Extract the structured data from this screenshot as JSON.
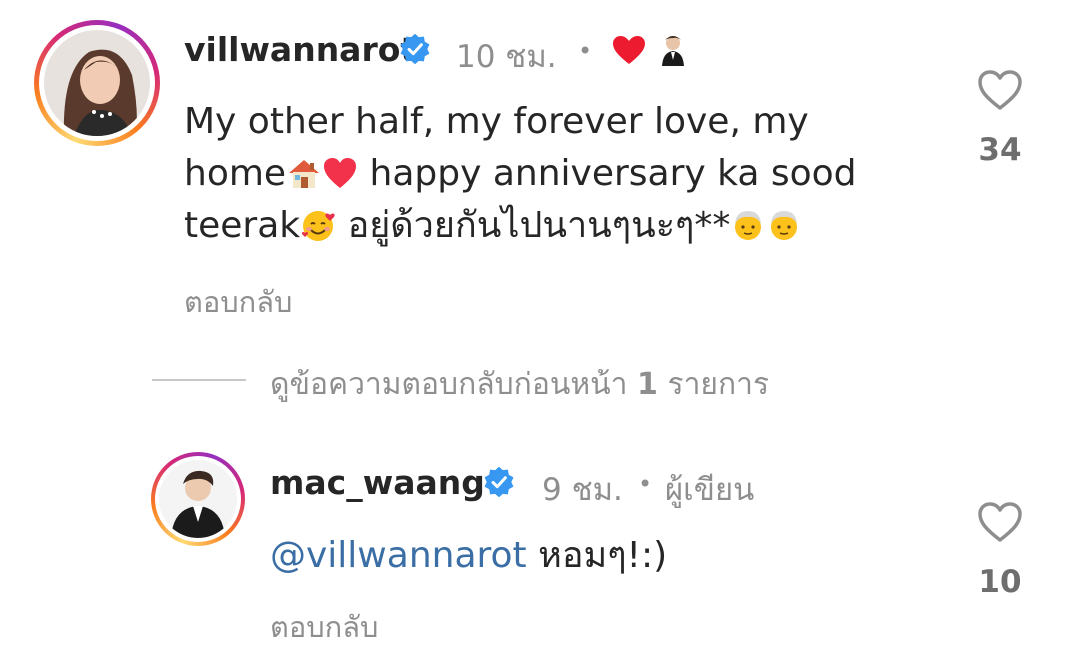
{
  "comment": {
    "username": "villwannarot",
    "time": "10 ชม.",
    "separator": "•",
    "text_line1": "My other half, my forever love, my",
    "text_line2a": "home",
    "text_line2b": " happy anniversary ka sood",
    "text_line3a": "teerak",
    "text_line3b": " อยู่ด้วยกันไปนานๆนะๆ**",
    "reply_label": "ตอบกลับ",
    "like_count": "34",
    "liked_by_author": true
  },
  "view_replies": {
    "prefix": "ดูข้อความตอบกลับก่อนหน้า",
    "count": "1",
    "suffix": "รายการ"
  },
  "reply": {
    "username": "mac_waang",
    "time": "9 ชม.",
    "separator": "•",
    "author_label": "ผู้เขียน",
    "mention": "@villwannarot",
    "text": " หอมๆ!:)",
    "reply_label": "ตอบกลับ",
    "like_count": "10"
  },
  "colors": {
    "verified": "#3897f0",
    "liked_heart": "#ed4956",
    "mention": "#3a6ea5"
  }
}
